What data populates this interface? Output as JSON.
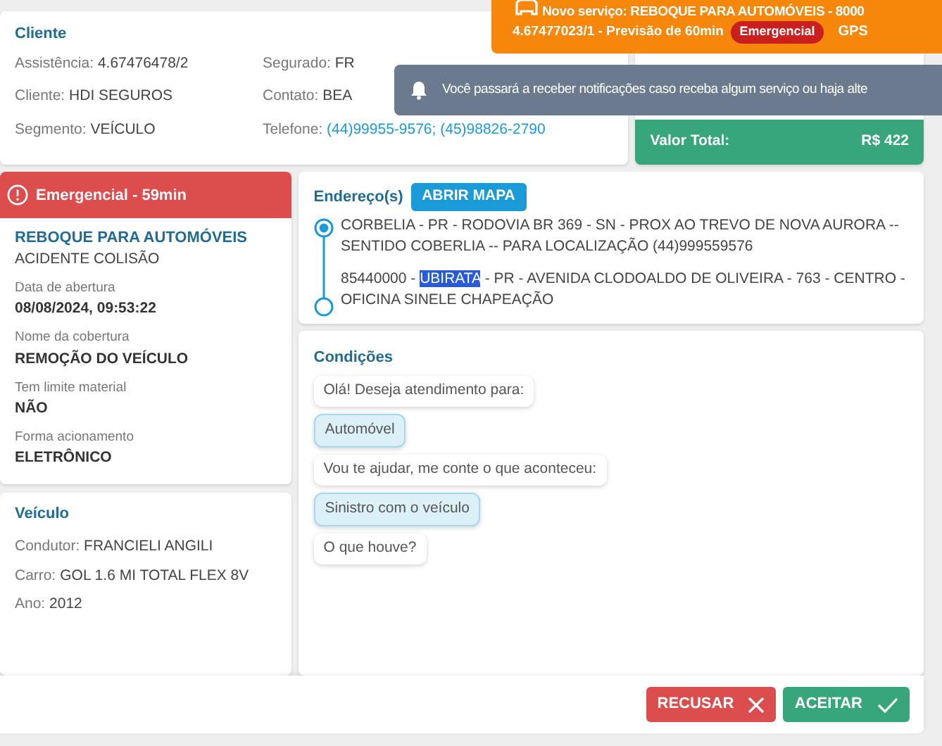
{
  "notification": {
    "title": "Novo serviço: REBOQUE PARA AUTOMÓVEIS - 8000",
    "code": "4.67477023/1 - Previsão de 60min",
    "badge": "Emergencial",
    "tag": "GPS"
  },
  "toast": {
    "message": "Você passará a receber notificações caso receba algum serviço ou haja alte"
  },
  "client": {
    "title": "Cliente",
    "fields": [
      {
        "label": "Assistência:",
        "value": "4.67476478/2",
        "kind": "text"
      },
      {
        "label": "Segurado:",
        "value": "FR",
        "kind": "text"
      },
      {
        "label": "Cliente:",
        "value": "HDI SEGUROS",
        "kind": "text"
      },
      {
        "label": "Contato:",
        "value": "BEA",
        "kind": "text"
      },
      {
        "label": "Segmento:",
        "value": "VEÍCULO",
        "kind": "text"
      },
      {
        "label": "Telefone:",
        "value": "(44)99955-9576; (45)98826-2790",
        "kind": "link"
      }
    ]
  },
  "total": {
    "label": "Valor Total:",
    "value": "R$ 422"
  },
  "alert": "Emergencial - 59min",
  "service": {
    "title": "REBOQUE PARA AUTOMÓVEIS",
    "subtitle": "ACIDENTE COLISÃO",
    "details": [
      {
        "label": "Data de abertura",
        "value": "08/08/2024, 09:53:22"
      },
      {
        "label": "Nome da cobertura",
        "value": "REMOÇÃO DO VEÍCULO"
      },
      {
        "label": "Tem limite material",
        "value": "NÃO"
      },
      {
        "label": "Forma acionamento",
        "value": "ELETRÔNICO"
      }
    ]
  },
  "vehicle": {
    "title": "Veículo",
    "fields": [
      {
        "label": "Condutor:",
        "value": "FRANCIELI ANGILI"
      },
      {
        "label": "Carro:",
        "value": "GOL 1.6 MI TOTAL FLEX 8V"
      },
      {
        "label": "Ano:",
        "value": "2012"
      }
    ]
  },
  "addresses": {
    "title": "Endereço(s)",
    "button": "ABRIR MAPA",
    "items": [
      {
        "before": "CORBELIA - PR - RODOVIA BR 369 - SN - PROX AO TREVO DE NOVA AURORA -- SENTIDO COBERLIA -- PARA LOCALIZAÇÃO (44)999559576",
        "current": true
      },
      {
        "before": "85440000 - ",
        "selected_text": "UBIRATA",
        "after": " - PR - AVENIDA CLODOALDO DE OLIVEIRA - 763 - CENTRO - OFICINA SINELE CHAPEAÇÃO",
        "current": false
      }
    ]
  },
  "conditions": {
    "title": "Condições",
    "messages": [
      {
        "text": "Olá! Deseja atendimento para:",
        "kind": "question"
      },
      {
        "text": "Automóvel",
        "kind": "answer"
      },
      {
        "text": "Vou te ajudar, me conte o que aconteceu:",
        "kind": "question"
      },
      {
        "text": "Sinistro com o veículo",
        "kind": "answer"
      },
      {
        "text": "O que houve?",
        "kind": "question"
      }
    ]
  },
  "buttons": [
    {
      "label": "RECUSAR",
      "kind": "reject"
    },
    {
      "label": "ACEITAR",
      "kind": "accept"
    }
  ]
}
